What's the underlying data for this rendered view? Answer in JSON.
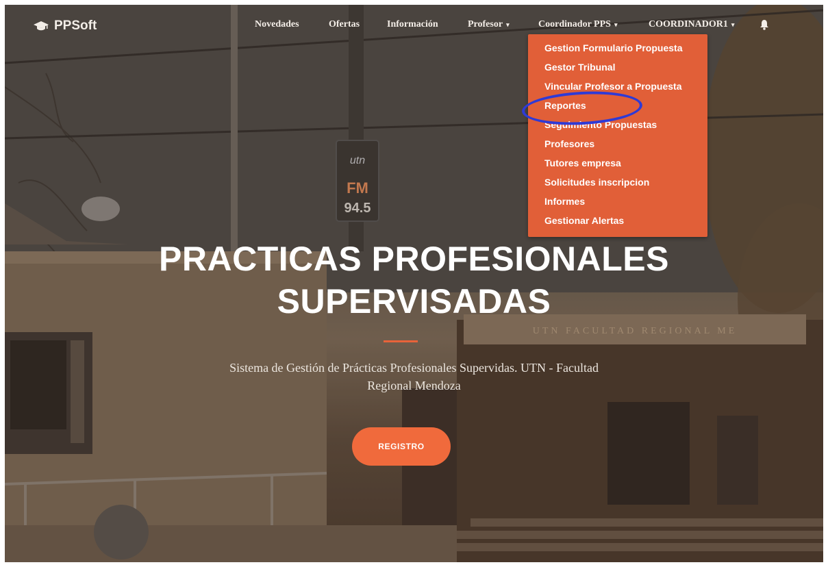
{
  "brand": {
    "name": "PPSoft",
    "icon": "graduation-cap-icon"
  },
  "nav": {
    "items": [
      {
        "label": "Novedades"
      },
      {
        "label": "Ofertas"
      },
      {
        "label": "Información"
      },
      {
        "label": "Profesor",
        "caret": "▾"
      },
      {
        "label": "Coordinador PPS",
        "caret": "▾"
      },
      {
        "label": "COORDINADOR1",
        "caret": "▾"
      }
    ],
    "bell_icon": "bell-icon"
  },
  "dropdown": {
    "items": [
      {
        "label": "Gestion Formulario Propuesta"
      },
      {
        "label": "Gestor Tribunal"
      },
      {
        "label": "Vincular Profesor a Propuesta"
      },
      {
        "label": "Reportes",
        "highlighted": true
      },
      {
        "label": "Seguimiento Propuestas"
      },
      {
        "label": "Profesores"
      },
      {
        "label": "Tutores empresa"
      },
      {
        "label": "Solicitudes inscripcion"
      },
      {
        "label": "Informes"
      },
      {
        "label": "Gestionar Alertas"
      }
    ]
  },
  "hero": {
    "title_line1": "PRACTICAS PROFESIONALES",
    "title_line2": "SUPERVISADAS",
    "subtitle_line1": "Sistema de Gestión de Prácticas Profesionales Supervidas. UTN - Facultad",
    "subtitle_line2": "Regional Mendoza",
    "button": "REGISTRO",
    "sign_fm": "FM",
    "sign_freq": "94.5",
    "sign_utn": "utn",
    "building_sign": "UTN   FACULTAD   REGIONAL   ME"
  },
  "colors": {
    "accent": "#e15f38",
    "button": "#f06a3c",
    "highlight_ring": "#2f3ad6"
  }
}
